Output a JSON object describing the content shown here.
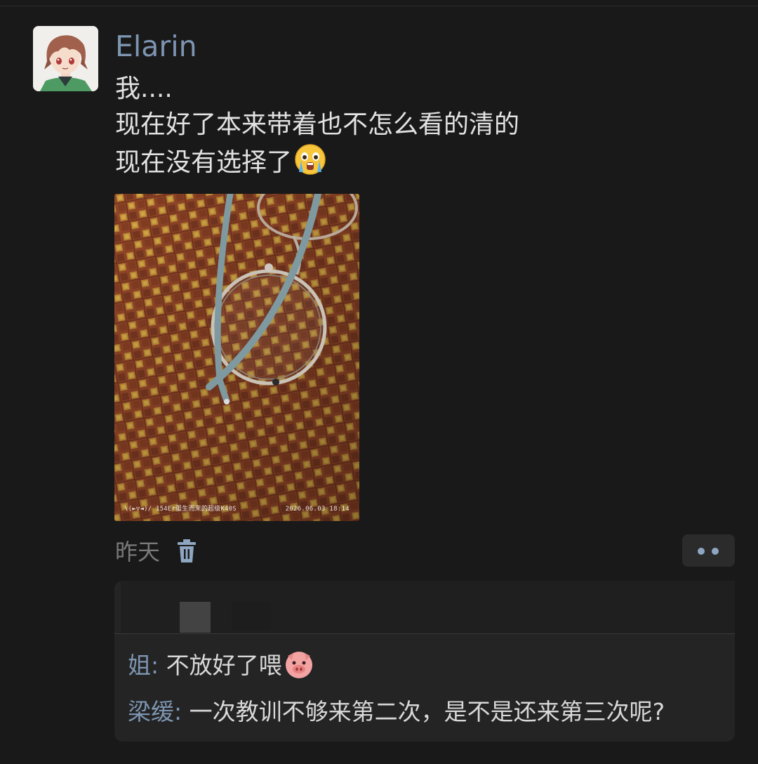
{
  "post": {
    "author": "Elarin",
    "lines": [
      "我....",
      "现在好了本来带着也不怎么看的清的",
      "现在没有选择了"
    ],
    "line3_emoji": "crying-face",
    "photo": {
      "caption_left": "\\(►▽◄)/ 154Er蛋生而来的超级K40S",
      "caption_right": "2026.06.03  18:14"
    },
    "time": "昨天"
  },
  "comments": [
    {
      "author": "姐",
      "sep": ":",
      "text": " 不放好了喂",
      "emoji": "pig-face"
    },
    {
      "author": "梁缓",
      "sep": ":",
      "text": " 一次教训不够来第二次，是不是还来第三次呢?"
    }
  ],
  "colors": {
    "background": "#191919",
    "name_link": "#7d95b1",
    "text": "#e2e2e2",
    "panel": "#242424"
  },
  "icons": [
    "trash-icon",
    "more-dots-icon"
  ]
}
